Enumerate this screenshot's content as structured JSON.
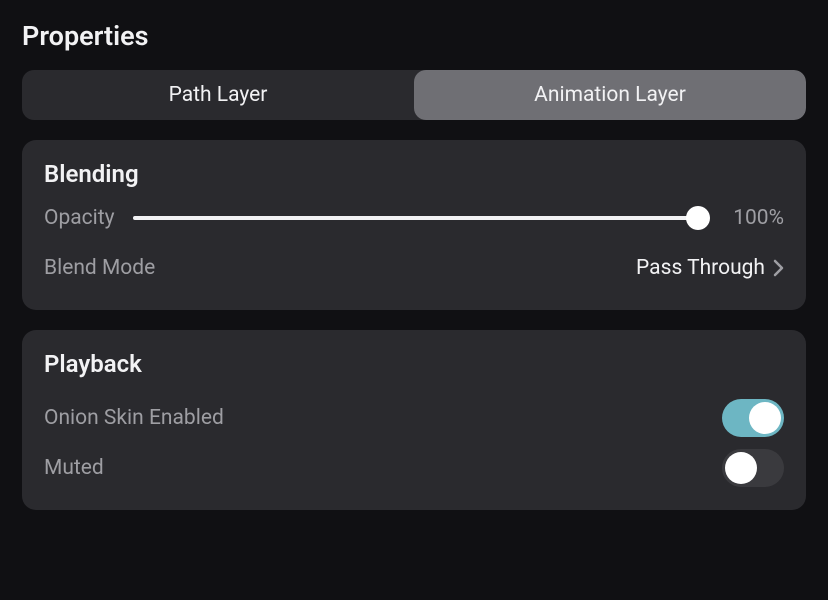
{
  "panel": {
    "title": "Properties"
  },
  "tabs": {
    "items": [
      {
        "label": "Path Layer",
        "active": false
      },
      {
        "label": "Animation Layer",
        "active": true
      }
    ]
  },
  "sections": {
    "blending": {
      "title": "Blending",
      "opacity": {
        "label": "Opacity",
        "value_text": "100%",
        "percent": 100
      },
      "blend_mode": {
        "label": "Blend Mode",
        "value": "Pass Through"
      }
    },
    "playback": {
      "title": "Playback",
      "onion_skin": {
        "label": "Onion Skin Enabled",
        "on": true
      },
      "muted": {
        "label": "Muted",
        "on": false
      }
    }
  }
}
